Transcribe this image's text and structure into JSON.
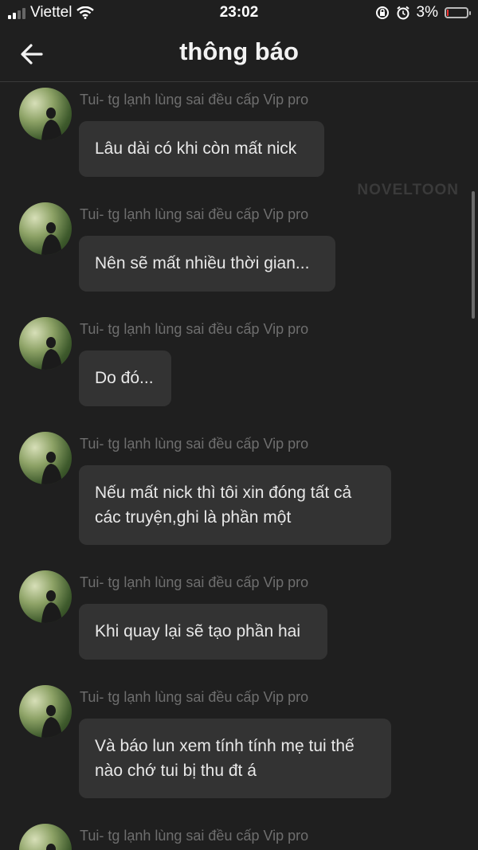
{
  "status_bar": {
    "carrier": "Viettel",
    "time": "23:02",
    "battery_percent": "3%"
  },
  "header": {
    "title": "thông báo"
  },
  "watermark": "NOVELTOON",
  "messages": [
    {
      "sender": "Tui- tg lạnh lùng sai đều cấp Vip pro",
      "text": "Lâu dài có khi còn mất nick"
    },
    {
      "sender": "Tui- tg lạnh lùng sai đều cấp Vip pro",
      "text": "Nên sẽ mất nhiều thời gian..."
    },
    {
      "sender": "Tui- tg lạnh lùng sai đều cấp Vip pro",
      "text": "Do đó..."
    },
    {
      "sender": "Tui- tg lạnh lùng sai đều cấp Vip pro",
      "text": "Nếu mất nick thì tôi xin đóng tất cả các truyện,ghi là phần một"
    },
    {
      "sender": "Tui- tg lạnh lùng sai đều cấp Vip pro",
      "text": "Khi quay lại sẽ tạo phần hai"
    },
    {
      "sender": "Tui- tg lạnh lùng sai đều cấp Vip pro",
      "text": "Và báo lun xem tính tính mẹ tui thế nào chớ tui bị thu đt á"
    },
    {
      "sender": "Tui- tg lạnh lùng sai đều cấp Vip pro",
      "text": ""
    }
  ]
}
